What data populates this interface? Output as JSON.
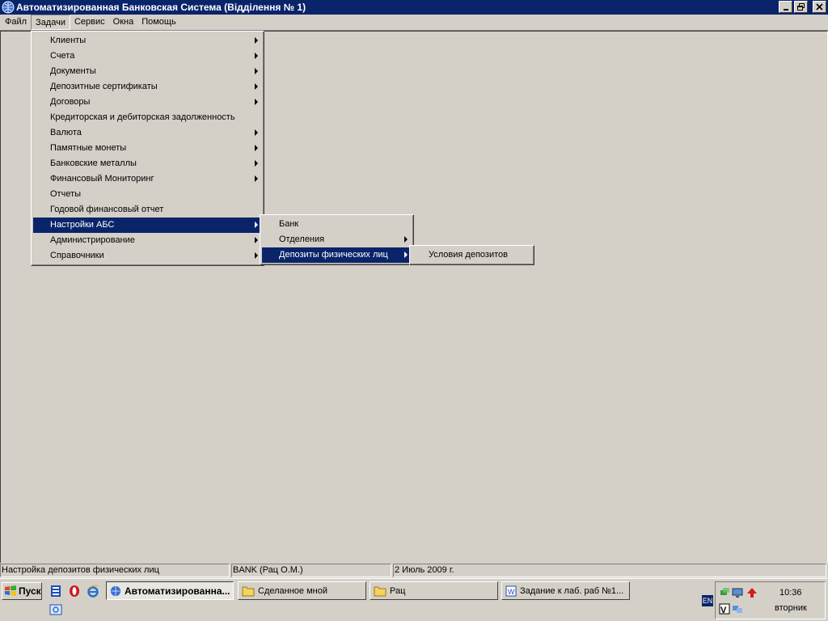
{
  "window": {
    "title": "Автоматизированная Банковская Система (Відділення № 1)"
  },
  "menubar": {
    "items": [
      "Файл",
      "Задачи",
      "Сервис",
      "Окна",
      "Помощь"
    ]
  },
  "tasks_menu": {
    "items": [
      {
        "label": "Клиенты",
        "submenu": true
      },
      {
        "label": "Счета",
        "submenu": true
      },
      {
        "label": "Документы",
        "submenu": true
      },
      {
        "label": "Депозитные сертификаты",
        "submenu": true
      },
      {
        "label": "Договоры",
        "submenu": true
      },
      {
        "label": "Кредиторская и дебиторская задолженность",
        "submenu": false
      },
      {
        "label": "Валюта",
        "submenu": true
      },
      {
        "label": "Памятные монеты",
        "submenu": true
      },
      {
        "label": "Банковские металлы",
        "submenu": true
      },
      {
        "label": "Финансовый Мониторинг",
        "submenu": true
      },
      {
        "label": "Отчеты",
        "submenu": false
      },
      {
        "label": "Годовой финансовый отчет",
        "submenu": false
      },
      {
        "label": "Настройки АБС",
        "submenu": true,
        "highlighted": true
      },
      {
        "label": "Администрирование",
        "submenu": true
      },
      {
        "label": "Справочники",
        "submenu": true
      }
    ]
  },
  "settings_menu": {
    "items": [
      {
        "label": "Банк",
        "submenu": false
      },
      {
        "label": "Отделения",
        "submenu": true
      },
      {
        "label": "Депозиты физических лиц",
        "submenu": true,
        "highlighted": true
      }
    ]
  },
  "deposits_menu": {
    "items": [
      {
        "label": "Условия депозитов",
        "submenu": false
      }
    ]
  },
  "statusbar": {
    "hint": "Настройка депозитов физических лиц",
    "user": "BANK (Рац О.М.)",
    "date": "2 Июль 2009 г."
  },
  "taskbar": {
    "start_label": "Пуск",
    "buttons": [
      "Автоматизированна...",
      "Сделанное мной",
      "Рац",
      "Задание к лаб. раб №1..."
    ],
    "language": "EN",
    "time": "10:36",
    "day": "вторник"
  },
  "colors": {
    "highlight": "#0a246a",
    "face": "#d4d0c8"
  }
}
